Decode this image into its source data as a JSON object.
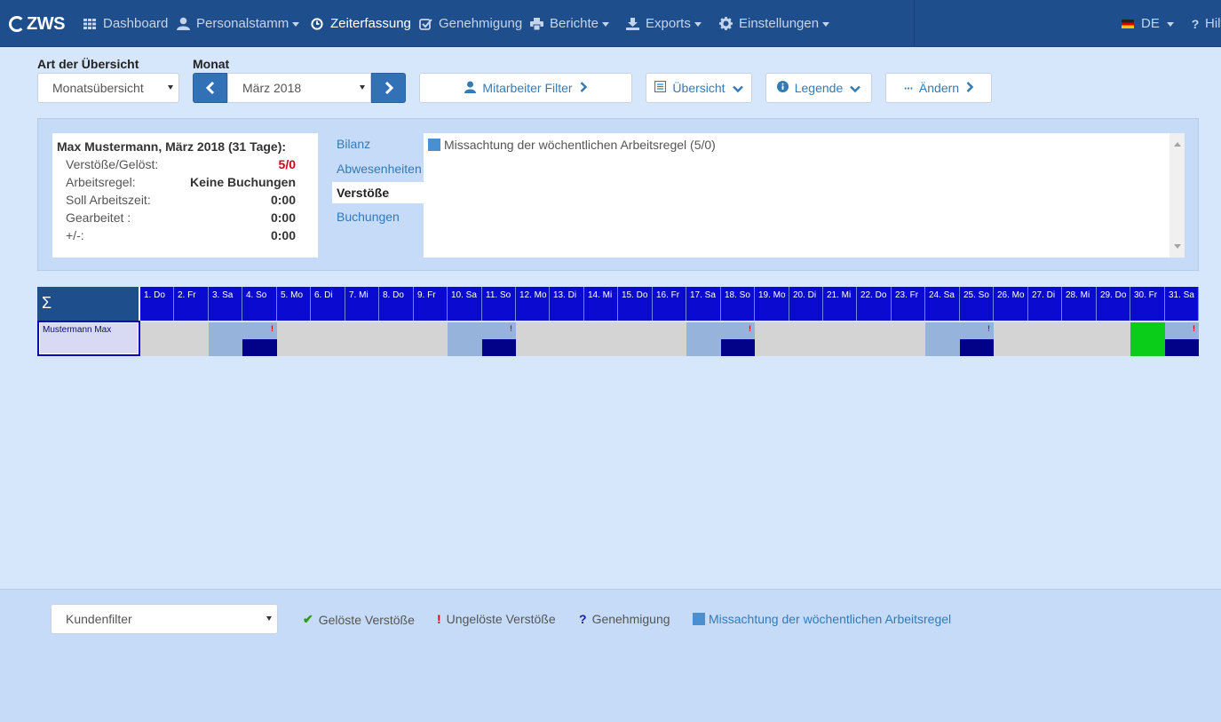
{
  "navbar": {
    "logo": "ZWS",
    "items": [
      {
        "label": "Dashboard",
        "icon": "grid-icon"
      },
      {
        "label": "Personalstamm",
        "icon": "user-icon"
      },
      {
        "label": "Zeiterfassung",
        "icon": "clock-icon"
      },
      {
        "label": "Genehmigung",
        "icon": "check-square-icon"
      },
      {
        "label": "Berichte",
        "icon": "printer-icon"
      },
      {
        "label": "Exports",
        "icon": "export-icon"
      },
      {
        "label": "Einstellungen",
        "icon": "gear-icon"
      }
    ],
    "language": "DE",
    "help": "Hilfe"
  },
  "toolbar": {
    "overview_type_label": "Art der Übersicht",
    "overview_type_value": "Monatsübersicht",
    "month_label": "Monat",
    "month_value": "März 2018",
    "employee_filter": "Mitarbeiter Filter",
    "overview_button": "Übersicht",
    "legend_button": "Legende",
    "change_button": "Ändern"
  },
  "summary": {
    "title": "Max Mustermann, März 2018 (31 Tage):",
    "rows": [
      {
        "label": "Verstöße/Gelöst:",
        "value": "5/0"
      },
      {
        "label": "Arbeitsregel:",
        "value": "Keine Buchungen"
      },
      {
        "label": "Soll Arbeitszeit:",
        "value": "0:00"
      },
      {
        "label": "Gearbeitet :",
        "value": "0:00"
      },
      {
        "label": "+/-:",
        "value": "0:00"
      }
    ]
  },
  "tabs": [
    "Bilanz",
    "Abwesenheiten",
    "Verstöße",
    "Buchungen"
  ],
  "active_tab": "Verstöße",
  "violations": [
    {
      "text": "Missachtung der wöchentlichen Arbeitsregel (5/0)",
      "color": "#4a8fd0"
    }
  ],
  "calendar": {
    "sigma": "Σ",
    "employee": "Mustermann Max",
    "days": [
      "1. Do",
      "2. Fr",
      "3. Sa",
      "4. So",
      "5. Mo",
      "6. Di",
      "7. Mi",
      "8. Do",
      "9. Fr",
      "10. Sa",
      "11. So",
      "12. Mo",
      "13. Di",
      "14. Mi",
      "15. Do",
      "16. Fr",
      "17. Sa",
      "18. So",
      "19. Mo",
      "20. Di",
      "21. Mi",
      "22. Do",
      "23. Fr",
      "24. Sa",
      "25. So",
      "26. Mo",
      "27. Di",
      "28. Mi",
      "29. Do",
      "30. Fr",
      "31. Sa"
    ],
    "cell_types": [
      "gray",
      "gray",
      "weekend",
      "violation",
      "gray",
      "gray",
      "gray",
      "gray",
      "gray",
      "weekend",
      "violation",
      "gray",
      "gray",
      "gray",
      "gray",
      "gray",
      "weekend",
      "violation",
      "gray",
      "gray",
      "gray",
      "gray",
      "gray",
      "weekend",
      "violation",
      "gray",
      "gray",
      "gray",
      "gray",
      "green",
      "violation"
    ],
    "violation_mark": "!"
  },
  "footer": {
    "customer_filter": "Kundenfilter",
    "legend": [
      {
        "symbol": "✔",
        "label": "Gelöste Verstöße"
      },
      {
        "symbol": "!",
        "label": "Ungelöste Verstöße"
      },
      {
        "symbol": "?",
        "label": "Genehmigung"
      },
      {
        "symbol": "",
        "label": "Missachtung der wöchentlichen Arbeitsregel"
      }
    ]
  }
}
